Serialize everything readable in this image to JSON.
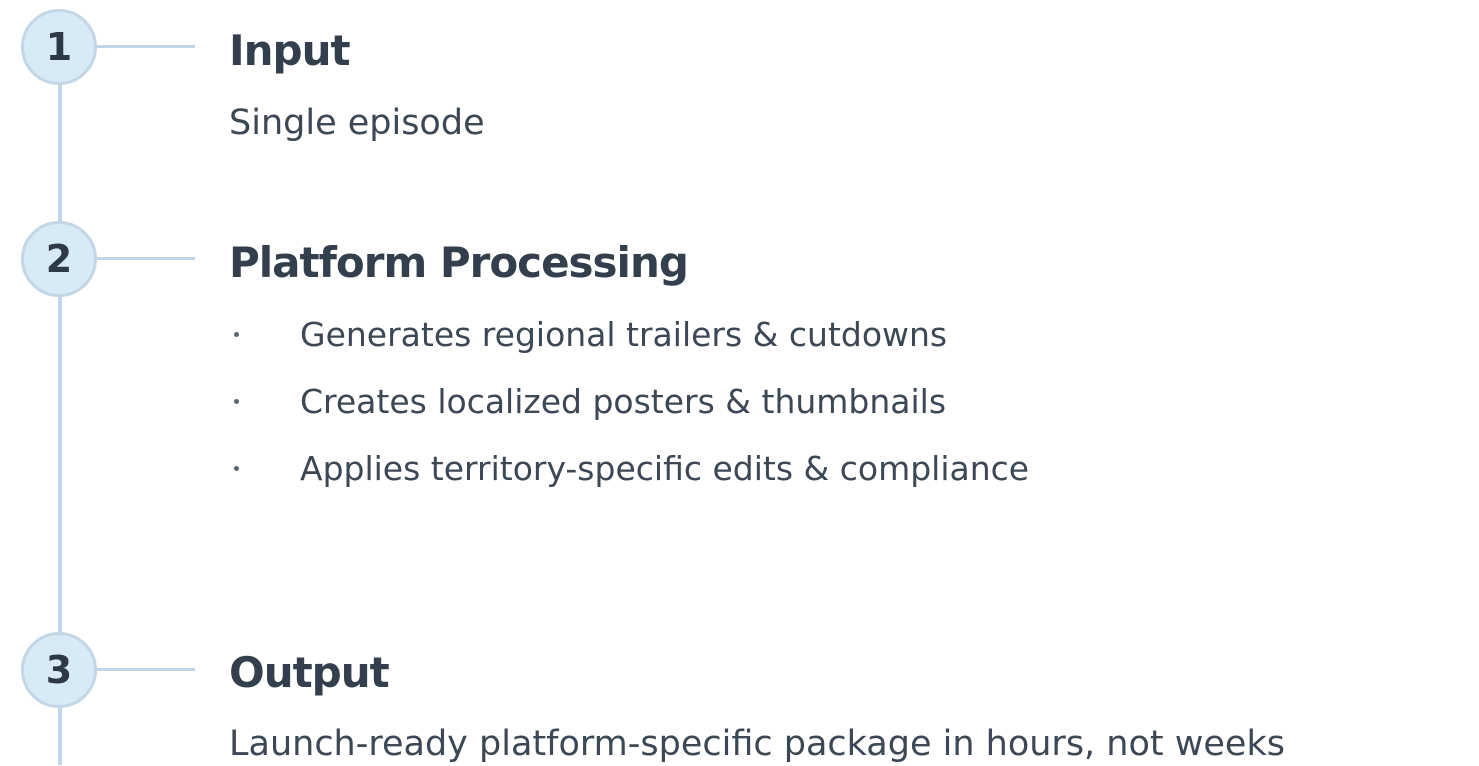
{
  "steps": [
    {
      "number": "1",
      "title": "Input",
      "description": "Single episode"
    },
    {
      "number": "2",
      "title": "Platform Processing",
      "bullets": [
        "Generates regional trailers & cutdowns",
        "Creates localized posters & thumbnails",
        "Applies territory-specific edits & compliance"
      ]
    },
    {
      "number": "3",
      "title": "Output",
      "description": "Launch-ready platform-specific package in hours, not weeks"
    }
  ],
  "colors": {
    "circle_fill": "#d9eaf7",
    "line": "#c3d6e5",
    "text": "#333f4c"
  }
}
